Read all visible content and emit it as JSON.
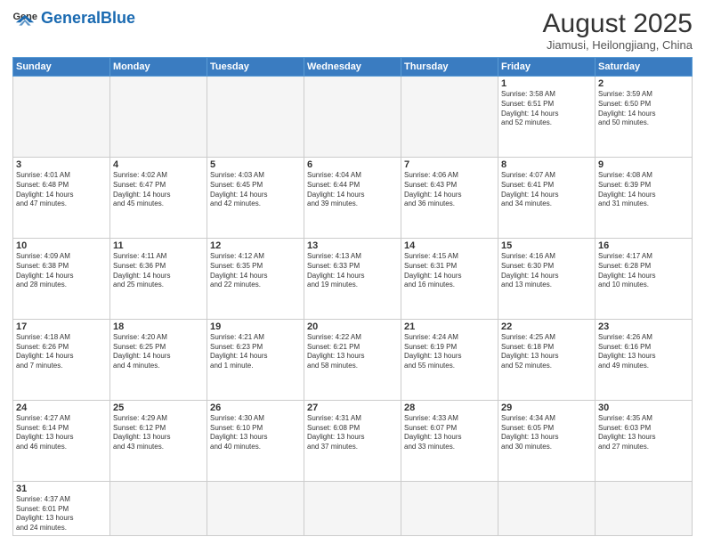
{
  "header": {
    "logo_general": "General",
    "logo_blue": "Blue",
    "month_year": "August 2025",
    "location": "Jiamusi, Heilongjiang, China"
  },
  "weekdays": [
    "Sunday",
    "Monday",
    "Tuesday",
    "Wednesday",
    "Thursday",
    "Friday",
    "Saturday"
  ],
  "days": {
    "1": {
      "sunrise": "3:58 AM",
      "sunset": "6:51 PM",
      "daylight": "14 hours and 52 minutes."
    },
    "2": {
      "sunrise": "3:59 AM",
      "sunset": "6:50 PM",
      "daylight": "14 hours and 50 minutes."
    },
    "3": {
      "sunrise": "4:01 AM",
      "sunset": "6:48 PM",
      "daylight": "14 hours and 47 minutes."
    },
    "4": {
      "sunrise": "4:02 AM",
      "sunset": "6:47 PM",
      "daylight": "14 hours and 45 minutes."
    },
    "5": {
      "sunrise": "4:03 AM",
      "sunset": "6:45 PM",
      "daylight": "14 hours and 42 minutes."
    },
    "6": {
      "sunrise": "4:04 AM",
      "sunset": "6:44 PM",
      "daylight": "14 hours and 39 minutes."
    },
    "7": {
      "sunrise": "4:06 AM",
      "sunset": "6:43 PM",
      "daylight": "14 hours and 36 minutes."
    },
    "8": {
      "sunrise": "4:07 AM",
      "sunset": "6:41 PM",
      "daylight": "14 hours and 34 minutes."
    },
    "9": {
      "sunrise": "4:08 AM",
      "sunset": "6:39 PM",
      "daylight": "14 hours and 31 minutes."
    },
    "10": {
      "sunrise": "4:09 AM",
      "sunset": "6:38 PM",
      "daylight": "14 hours and 28 minutes."
    },
    "11": {
      "sunrise": "4:11 AM",
      "sunset": "6:36 PM",
      "daylight": "14 hours and 25 minutes."
    },
    "12": {
      "sunrise": "4:12 AM",
      "sunset": "6:35 PM",
      "daylight": "14 hours and 22 minutes."
    },
    "13": {
      "sunrise": "4:13 AM",
      "sunset": "6:33 PM",
      "daylight": "14 hours and 19 minutes."
    },
    "14": {
      "sunrise": "4:15 AM",
      "sunset": "6:31 PM",
      "daylight": "14 hours and 16 minutes."
    },
    "15": {
      "sunrise": "4:16 AM",
      "sunset": "6:30 PM",
      "daylight": "14 hours and 13 minutes."
    },
    "16": {
      "sunrise": "4:17 AM",
      "sunset": "6:28 PM",
      "daylight": "14 hours and 10 minutes."
    },
    "17": {
      "sunrise": "4:18 AM",
      "sunset": "6:26 PM",
      "daylight": "14 hours and 7 minutes."
    },
    "18": {
      "sunrise": "4:20 AM",
      "sunset": "6:25 PM",
      "daylight": "14 hours and 4 minutes."
    },
    "19": {
      "sunrise": "4:21 AM",
      "sunset": "6:23 PM",
      "daylight": "14 hours and 1 minute."
    },
    "20": {
      "sunrise": "4:22 AM",
      "sunset": "6:21 PM",
      "daylight": "13 hours and 58 minutes."
    },
    "21": {
      "sunrise": "4:24 AM",
      "sunset": "6:19 PM",
      "daylight": "13 hours and 55 minutes."
    },
    "22": {
      "sunrise": "4:25 AM",
      "sunset": "6:18 PM",
      "daylight": "13 hours and 52 minutes."
    },
    "23": {
      "sunrise": "4:26 AM",
      "sunset": "6:16 PM",
      "daylight": "13 hours and 49 minutes."
    },
    "24": {
      "sunrise": "4:27 AM",
      "sunset": "6:14 PM",
      "daylight": "13 hours and 46 minutes."
    },
    "25": {
      "sunrise": "4:29 AM",
      "sunset": "6:12 PM",
      "daylight": "13 hours and 43 minutes."
    },
    "26": {
      "sunrise": "4:30 AM",
      "sunset": "6:10 PM",
      "daylight": "13 hours and 40 minutes."
    },
    "27": {
      "sunrise": "4:31 AM",
      "sunset": "6:08 PM",
      "daylight": "13 hours and 37 minutes."
    },
    "28": {
      "sunrise": "4:33 AM",
      "sunset": "6:07 PM",
      "daylight": "13 hours and 33 minutes."
    },
    "29": {
      "sunrise": "4:34 AM",
      "sunset": "6:05 PM",
      "daylight": "13 hours and 30 minutes."
    },
    "30": {
      "sunrise": "4:35 AM",
      "sunset": "6:03 PM",
      "daylight": "13 hours and 27 minutes."
    },
    "31": {
      "sunrise": "4:37 AM",
      "sunset": "6:01 PM",
      "daylight": "13 hours and 24 minutes."
    }
  }
}
